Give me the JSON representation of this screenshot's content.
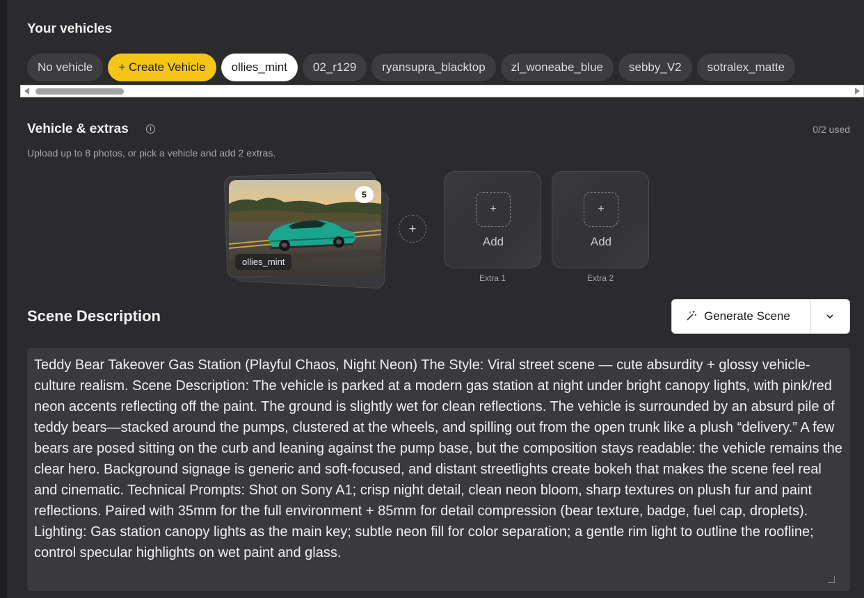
{
  "vehicles": {
    "title": "Your vehicles",
    "chips": [
      {
        "label": "No vehicle"
      },
      {
        "label": "+ Create Vehicle"
      },
      {
        "label": "ollies_mint"
      },
      {
        "label": "02_r129"
      },
      {
        "label": "ryansupra_blacktop"
      },
      {
        "label": "zl_woneabe_blue"
      },
      {
        "label": "sebby_V2"
      },
      {
        "label": "sotralex_matte"
      }
    ]
  },
  "extras": {
    "title": "Vehicle & extras",
    "used": "0/2 used",
    "subtitle": "Upload up to 8 photos, or pick a vehicle and add 2 extras.",
    "vehicle_label": "ollies_mint",
    "photo_count": "5",
    "slots": [
      {
        "add_label": "Add",
        "caption": "Extra 1"
      },
      {
        "add_label": "Add",
        "caption": "Extra 2"
      }
    ]
  },
  "scene": {
    "title": "Scene Description",
    "generate_label": "Generate Scene",
    "description": "Teddy Bear Takeover Gas Station (Playful Chaos, Night Neon) The Style: Viral street scene — cute absurdity + glossy vehicle-culture realism. Scene Description: The vehicle is parked at a modern gas station at night under bright canopy lights, with pink/red neon accents reflecting off the paint. The ground is slightly wet for clean reflections. The vehicle is surrounded by an absurd pile of teddy bears—stacked around the pumps, clustered at the wheels, and spilling out from the open trunk like a plush “delivery.” A few bears are posed sitting on the curb and leaning against the pump base, but the composition stays readable: the vehicle remains the clear hero. Background signage is generic and soft-focused, and distant streetlights create bokeh that makes the scene feel real and cinematic. Technical Prompts: Shot on Sony A1; crisp night detail, clean neon bloom, sharp textures on plush fur and paint reflections. Paired with 35mm for the full environment + 85mm for detail compression (bear texture, badge, fuel cap, droplets). Lighting: Gas station canopy lights as the main key; subtle neon fill for color separation; a gentle rim light to outline the roofline; control specular highlights on wet paint and glass."
  },
  "colors": {
    "accent_yellow": "#f5c518",
    "panel": "#2b2b2d",
    "chip": "#3d3d40"
  }
}
